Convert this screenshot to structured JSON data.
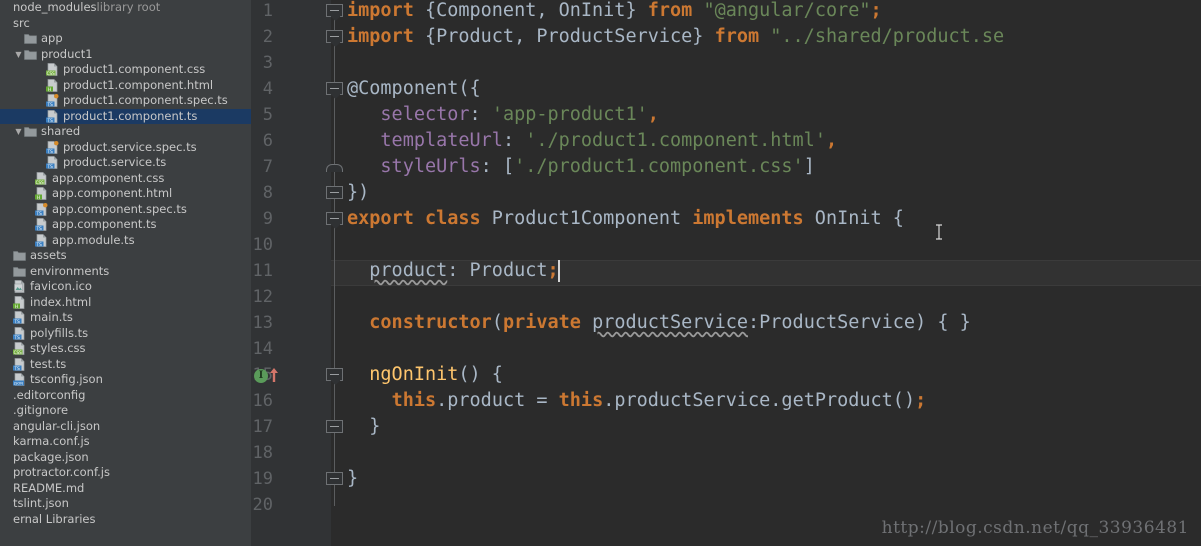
{
  "sidebar": {
    "rows": [
      {
        "indent": 0,
        "arrow": "",
        "icon": "",
        "label": "node_modules",
        "suffix": "library root",
        "selected": false,
        "bold": false
      },
      {
        "indent": 0,
        "arrow": "",
        "icon": "",
        "label": "src",
        "suffix": "",
        "selected": false,
        "bold": false
      },
      {
        "indent": 1,
        "arrow": "",
        "icon": "folder",
        "label": "app",
        "suffix": "",
        "selected": false,
        "bold": false
      },
      {
        "indent": 1,
        "arrow": "▼",
        "icon": "folder",
        "label": "product1",
        "suffix": "",
        "selected": false,
        "bold": false
      },
      {
        "indent": 3,
        "arrow": "",
        "icon": "file-css",
        "label": "product1.component.css",
        "suffix": "",
        "selected": false,
        "bold": false
      },
      {
        "indent": 3,
        "arrow": "",
        "icon": "file-html",
        "label": "product1.component.html",
        "suffix": "",
        "selected": false,
        "bold": false
      },
      {
        "indent": 3,
        "arrow": "",
        "icon": "file-spec-ts",
        "label": "product1.component.spec.ts",
        "suffix": "",
        "selected": false,
        "bold": false
      },
      {
        "indent": 3,
        "arrow": "",
        "icon": "file-ts",
        "label": "product1.component.ts",
        "suffix": "",
        "selected": true,
        "bold": false
      },
      {
        "indent": 1,
        "arrow": "▼",
        "icon": "folder",
        "label": "shared",
        "suffix": "",
        "selected": false,
        "bold": false
      },
      {
        "indent": 3,
        "arrow": "",
        "icon": "file-spec-ts",
        "label": "product.service.spec.ts",
        "suffix": "",
        "selected": false,
        "bold": false
      },
      {
        "indent": 3,
        "arrow": "",
        "icon": "file-ts",
        "label": "product.service.ts",
        "suffix": "",
        "selected": false,
        "bold": false
      },
      {
        "indent": 2,
        "arrow": "",
        "icon": "file-css",
        "label": "app.component.css",
        "suffix": "",
        "selected": false,
        "bold": false
      },
      {
        "indent": 2,
        "arrow": "",
        "icon": "file-html",
        "label": "app.component.html",
        "suffix": "",
        "selected": false,
        "bold": false
      },
      {
        "indent": 2,
        "arrow": "",
        "icon": "file-spec-ts",
        "label": "app.component.spec.ts",
        "suffix": "",
        "selected": false,
        "bold": false
      },
      {
        "indent": 2,
        "arrow": "",
        "icon": "file-ts",
        "label": "app.component.ts",
        "suffix": "",
        "selected": false,
        "bold": false
      },
      {
        "indent": 2,
        "arrow": "",
        "icon": "file-ts",
        "label": "app.module.ts",
        "suffix": "",
        "selected": false,
        "bold": false
      },
      {
        "indent": 0,
        "arrow": "",
        "icon": "folder",
        "label": "assets",
        "suffix": "",
        "selected": false,
        "bold": false
      },
      {
        "indent": 0,
        "arrow": "",
        "icon": "folder",
        "label": "environments",
        "suffix": "",
        "selected": false,
        "bold": false
      },
      {
        "indent": 0,
        "arrow": "",
        "icon": "file-ico",
        "label": "favicon.ico",
        "suffix": "",
        "selected": false,
        "bold": false
      },
      {
        "indent": 0,
        "arrow": "",
        "icon": "file-html",
        "label": "index.html",
        "suffix": "",
        "selected": false,
        "bold": false
      },
      {
        "indent": 0,
        "arrow": "",
        "icon": "file-ts",
        "label": "main.ts",
        "suffix": "",
        "selected": false,
        "bold": false
      },
      {
        "indent": 0,
        "arrow": "",
        "icon": "file-ts",
        "label": "polyfills.ts",
        "suffix": "",
        "selected": false,
        "bold": false
      },
      {
        "indent": 0,
        "arrow": "",
        "icon": "file-css",
        "label": "styles.css",
        "suffix": "",
        "selected": false,
        "bold": false
      },
      {
        "indent": 0,
        "arrow": "",
        "icon": "file-ts",
        "label": "test.ts",
        "suffix": "",
        "selected": false,
        "bold": false
      },
      {
        "indent": 0,
        "arrow": "",
        "icon": "file-json",
        "label": "tsconfig.json",
        "suffix": "",
        "selected": false,
        "bold": false
      },
      {
        "indent": 0,
        "arrow": "",
        "icon": "",
        "label": ".editorconfig",
        "suffix": "",
        "selected": false,
        "bold": false
      },
      {
        "indent": 0,
        "arrow": "",
        "icon": "",
        "label": ".gitignore",
        "suffix": "",
        "selected": false,
        "bold": false
      },
      {
        "indent": 0,
        "arrow": "",
        "icon": "",
        "label": "angular-cli.json",
        "suffix": "",
        "selected": false,
        "bold": false
      },
      {
        "indent": 0,
        "arrow": "",
        "icon": "",
        "label": "karma.conf.js",
        "suffix": "",
        "selected": false,
        "bold": false
      },
      {
        "indent": 0,
        "arrow": "",
        "icon": "",
        "label": "package.json",
        "suffix": "",
        "selected": false,
        "bold": false
      },
      {
        "indent": 0,
        "arrow": "",
        "icon": "",
        "label": "protractor.conf.js",
        "suffix": "",
        "selected": false,
        "bold": false
      },
      {
        "indent": 0,
        "arrow": "",
        "icon": "",
        "label": "README.md",
        "suffix": "",
        "selected": false,
        "bold": false
      },
      {
        "indent": 0,
        "arrow": "",
        "icon": "",
        "label": "tslint.json",
        "suffix": "",
        "selected": false,
        "bold": false
      },
      {
        "indent": 0,
        "arrow": "",
        "icon": "",
        "label": "ernal Libraries",
        "suffix": "",
        "selected": false,
        "bold": false
      }
    ]
  },
  "editor": {
    "line_numbers": [
      "1",
      "2",
      "3",
      "4",
      "5",
      "6",
      "7",
      "8",
      "9",
      "10",
      "11",
      "12",
      "13",
      "14",
      "15",
      "16",
      "17",
      "18",
      "19",
      "20"
    ],
    "current_line": 11,
    "caret": {
      "line": 11,
      "column": 19
    },
    "gutter_marker": {
      "line": 15,
      "glyph": "I",
      "name": "implements-marker",
      "color": "#5a9b5a",
      "arrow_color": "#d4766a"
    },
    "lines": [
      {
        "n": 1,
        "tokens": [
          {
            "t": "import",
            "c": "kw"
          },
          {
            "t": " {Component, OnInit} ",
            "c": "pl"
          },
          {
            "t": "from",
            "c": "kw"
          },
          {
            "t": " ",
            "c": "pl"
          },
          {
            "t": "\"@angular/core\"",
            "c": "st"
          },
          {
            "t": ";",
            "c": "kw"
          }
        ]
      },
      {
        "n": 2,
        "tokens": [
          {
            "t": "import",
            "c": "kw"
          },
          {
            "t": " {Product, ProductService} ",
            "c": "pl"
          },
          {
            "t": "from",
            "c": "kw"
          },
          {
            "t": " ",
            "c": "pl"
          },
          {
            "t": "\"../shared/product.se",
            "c": "st"
          }
        ]
      },
      {
        "n": 3,
        "tokens": []
      },
      {
        "n": 4,
        "tokens": [
          {
            "t": "@Component({",
            "c": "pl"
          }
        ]
      },
      {
        "n": 5,
        "tokens": [
          {
            "t": "   ",
            "c": "pl"
          },
          {
            "t": "selector",
            "c": "fld"
          },
          {
            "t": ": ",
            "c": "pl"
          },
          {
            "t": "'app-product1'",
            "c": "st"
          },
          {
            "t": ",",
            "c": "kw"
          }
        ]
      },
      {
        "n": 6,
        "tokens": [
          {
            "t": "   ",
            "c": "pl"
          },
          {
            "t": "templateUrl",
            "c": "fld"
          },
          {
            "t": ": ",
            "c": "pl"
          },
          {
            "t": "'./product1.component.html'",
            "c": "st"
          },
          {
            "t": ",",
            "c": "kw"
          }
        ]
      },
      {
        "n": 7,
        "tokens": [
          {
            "t": "   ",
            "c": "pl"
          },
          {
            "t": "styleUrls",
            "c": "fld"
          },
          {
            "t": ": [",
            "c": "pl"
          },
          {
            "t": "'./product1.component.css'",
            "c": "st"
          },
          {
            "t": "]",
            "c": "pl"
          }
        ]
      },
      {
        "n": 8,
        "tokens": [
          {
            "t": "})",
            "c": "pl"
          }
        ]
      },
      {
        "n": 9,
        "tokens": [
          {
            "t": "export class",
            "c": "kw"
          },
          {
            "t": " Product1Component ",
            "c": "cls"
          },
          {
            "t": "implements",
            "c": "kw"
          },
          {
            "t": " OnInit {",
            "c": "pl"
          }
        ]
      },
      {
        "n": 10,
        "tokens": []
      },
      {
        "n": 11,
        "tokens": [
          {
            "t": "  ",
            "c": "pl"
          },
          {
            "t": "product",
            "c": "pl err"
          },
          {
            "t": ": Product",
            "c": "pl"
          },
          {
            "t": ";",
            "c": "kw"
          }
        ]
      },
      {
        "n": 12,
        "tokens": []
      },
      {
        "n": 13,
        "tokens": [
          {
            "t": "  ",
            "c": "pl"
          },
          {
            "t": "constructor",
            "c": "kw"
          },
          {
            "t": "(",
            "c": "pl"
          },
          {
            "t": "private",
            "c": "kw"
          },
          {
            "t": " ",
            "c": "pl"
          },
          {
            "t": "productService",
            "c": "pl err"
          },
          {
            "t": ":ProductService) { }",
            "c": "pl"
          }
        ]
      },
      {
        "n": 14,
        "tokens": []
      },
      {
        "n": 15,
        "tokens": [
          {
            "t": "  ",
            "c": "pl"
          },
          {
            "t": "ngOnInit",
            "c": "fn"
          },
          {
            "t": "() {",
            "c": "pl"
          }
        ]
      },
      {
        "n": 16,
        "tokens": [
          {
            "t": "    ",
            "c": "pl"
          },
          {
            "t": "this",
            "c": "kw"
          },
          {
            "t": ".product = ",
            "c": "pl"
          },
          {
            "t": "this",
            "c": "kw"
          },
          {
            "t": ".productService.getProduct()",
            "c": "pl"
          },
          {
            "t": ";",
            "c": "kw"
          }
        ]
      },
      {
        "n": 17,
        "tokens": [
          {
            "t": "  }",
            "c": "pl"
          }
        ]
      },
      {
        "n": 18,
        "tokens": []
      },
      {
        "n": 19,
        "tokens": [
          {
            "t": "}",
            "c": "pl"
          }
        ]
      },
      {
        "n": 20,
        "tokens": []
      }
    ]
  },
  "watermark": {
    "text": "http://blog.csdn.net/qq_33936481"
  },
  "colors": {
    "editor_bg": "#2b2b2b",
    "gutter_bg": "#313335",
    "sidebar_bg": "#3c3f41",
    "selection_bg": "#1b3a63",
    "current_line_bg": "#323232",
    "keyword": "#cc7832",
    "string": "#6a8759",
    "plain": "#a9b7c6",
    "function": "#ffc66d",
    "field": "#9876aa",
    "line_number": "#606366"
  }
}
